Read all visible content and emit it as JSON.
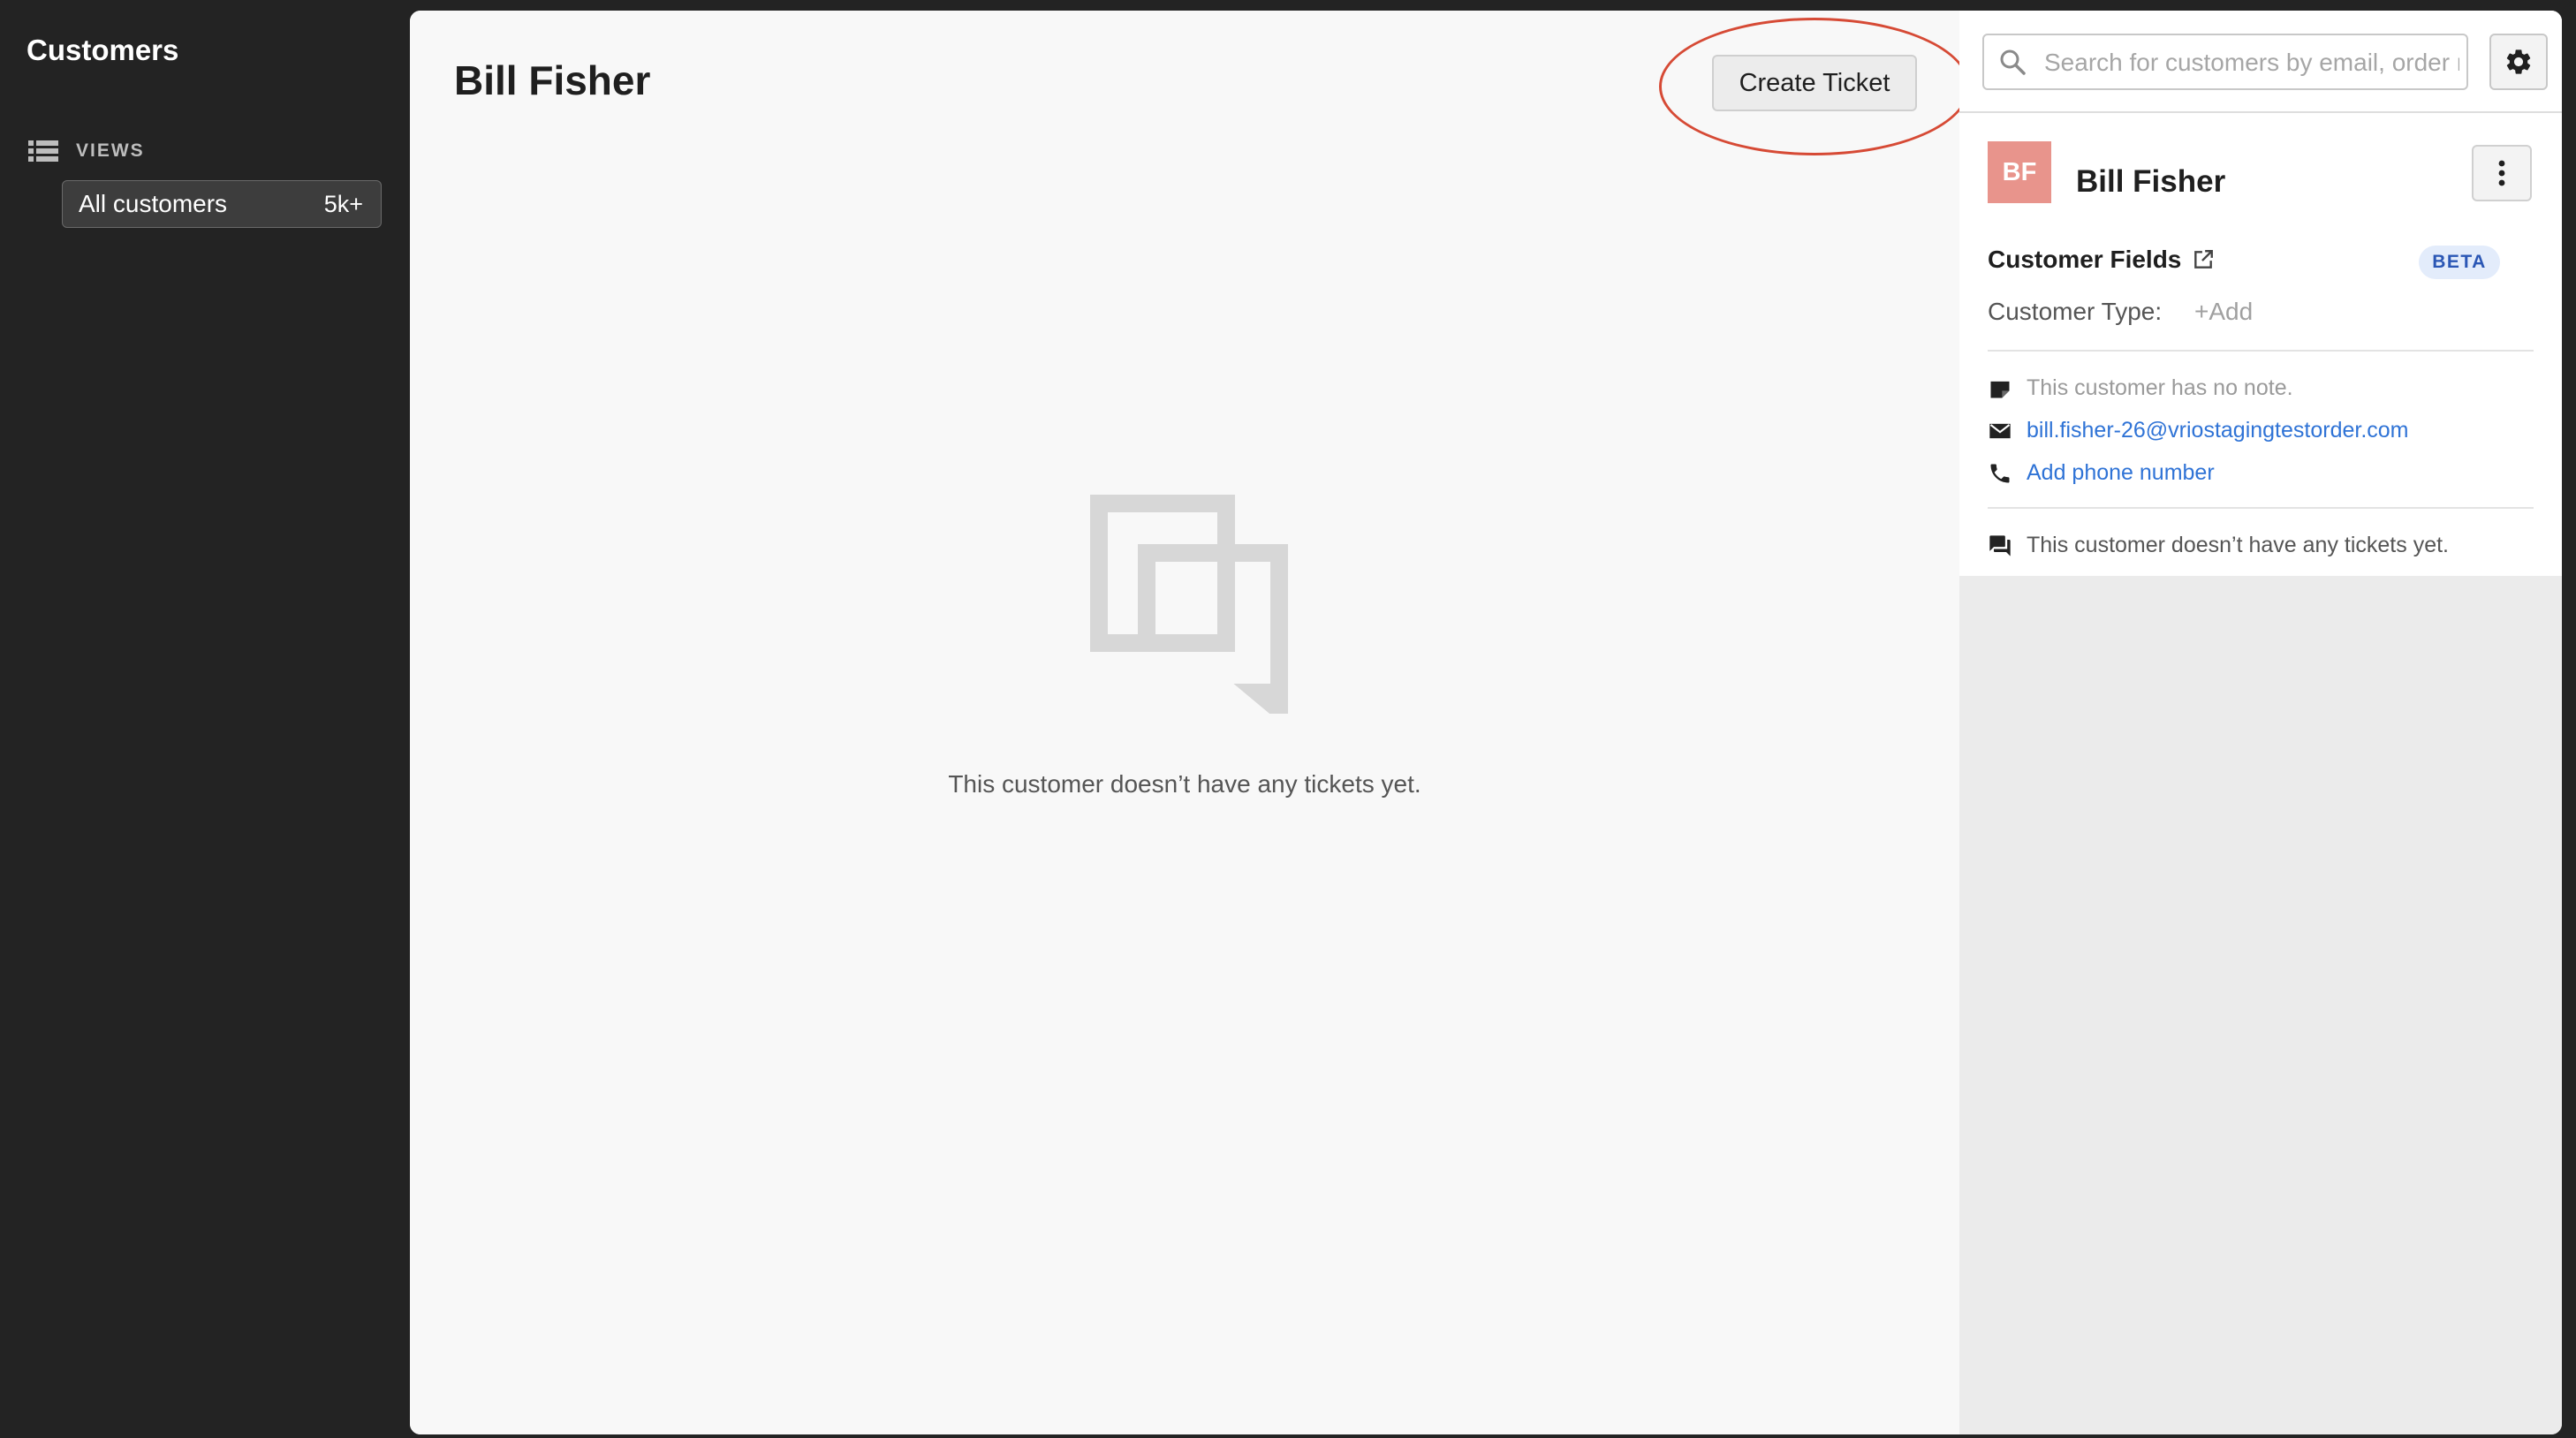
{
  "sidebar": {
    "title": "Customers",
    "views_label": "VIEWS",
    "views": [
      {
        "label": "All customers",
        "count": "5k+"
      }
    ]
  },
  "main": {
    "title": "Bill Fisher",
    "create_ticket_label": "Create Ticket",
    "empty_text": "This customer doesn’t have any tickets yet.",
    "highlight_color": "#d64a35"
  },
  "panel": {
    "search_placeholder": "Search for customers by email, order number, etc.",
    "avatar_initials": "BF",
    "avatar_color": "#e8948c",
    "customer_name": "Bill Fisher",
    "fields_title": "Customer Fields",
    "beta_badge": "BETA",
    "customer_type_label": "Customer Type:",
    "customer_type_add": "+Add",
    "note_text": "This customer has no note.",
    "email": "bill.fisher-26@vriostagingtestorder.com",
    "phone_link": "Add phone number",
    "tickets_text": "This customer doesn’t have any tickets yet."
  },
  "colors": {
    "link": "#2f73d6",
    "beta_bg": "#e3ecfb",
    "beta_text": "#2b57b5"
  }
}
